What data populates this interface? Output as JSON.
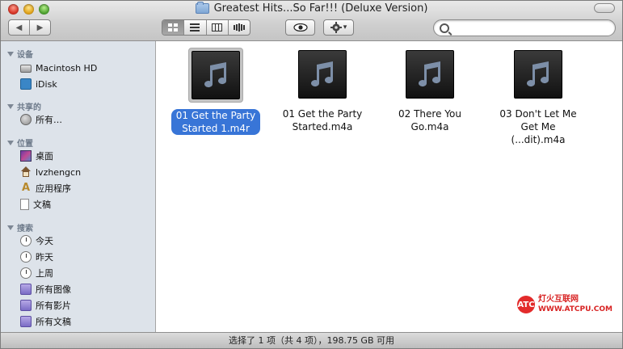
{
  "window": {
    "title": "Greatest Hits...So Far!!! (Deluxe Version)"
  },
  "toolbar": {
    "back_glyph": "◀",
    "forward_glyph": "▶",
    "gear_caret": "▾",
    "search": {
      "placeholder": "",
      "value": ""
    },
    "active_view": "icon"
  },
  "sidebar": {
    "devices": {
      "header": "设备",
      "items": [
        {
          "label": "Macintosh HD",
          "icon": "hard-disk-icon"
        },
        {
          "label": "iDisk",
          "icon": "idisk-icon"
        }
      ]
    },
    "shared": {
      "header": "共享的",
      "items": [
        {
          "label": "所有…",
          "icon": "network-icon"
        }
      ]
    },
    "places": {
      "header": "位置",
      "items": [
        {
          "label": "桌面",
          "icon": "desktop-icon"
        },
        {
          "label": "lvzhengcn",
          "icon": "home-icon"
        },
        {
          "label": "应用程序",
          "icon": "applications-icon"
        },
        {
          "label": "文稿",
          "icon": "documents-icon"
        }
      ]
    },
    "search": {
      "header": "搜索",
      "items": [
        {
          "label": "今天",
          "icon": "clock-icon"
        },
        {
          "label": "昨天",
          "icon": "clock-icon"
        },
        {
          "label": "上周",
          "icon": "clock-icon"
        },
        {
          "label": "所有图像",
          "icon": "smart-folder-icon"
        },
        {
          "label": "所有影片",
          "icon": "smart-folder-icon"
        },
        {
          "label": "所有文稿",
          "icon": "smart-folder-icon"
        }
      ]
    }
  },
  "files": [
    {
      "line1": "01 Get the Party",
      "line2": "Started 1.m4r",
      "selected": true
    },
    {
      "line1": "01 Get the Party",
      "line2": "Started.m4a",
      "selected": false
    },
    {
      "line1": "02 There You",
      "line2": "Go.m4a",
      "selected": false
    },
    {
      "line1": "03 Don't Let Me",
      "line2": "Get Me (...dit).m4a",
      "selected": false
    }
  ],
  "status": {
    "text": "选择了 1 项（共 4 项），198.75 GB 可用"
  },
  "watermark": {
    "dot": "ATC",
    "cn": "灯火互联网",
    "en": "WWW.ATCPU.COM"
  },
  "colors": {
    "selection": "#3875d7",
    "sidebar_bg": "#dde3ea",
    "sidebar_header": "#6d7a8a"
  }
}
